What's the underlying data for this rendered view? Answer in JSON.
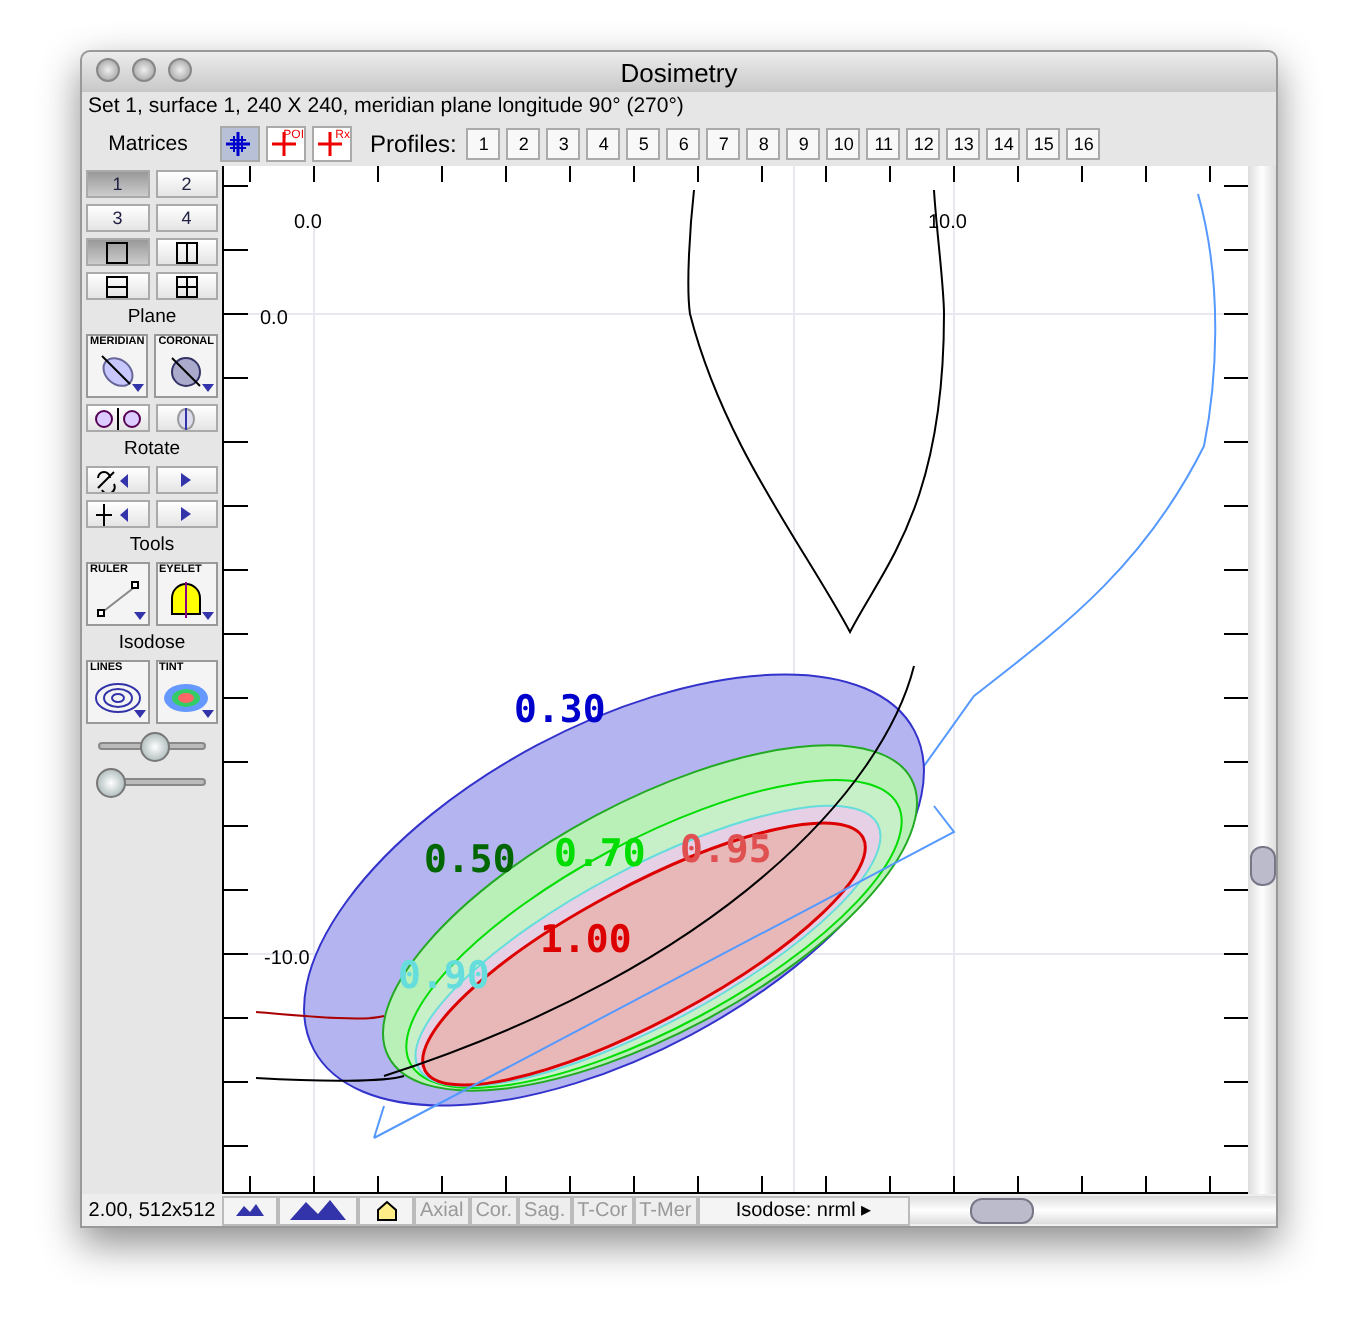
{
  "window": {
    "title": "Dosimetry"
  },
  "info": "Set 1, surface 1, 240 X 240, meridian plane longitude 90° (270°)",
  "toolbar": {
    "title": "Matrices",
    "tools": [
      {
        "kind": "cross",
        "selected": true
      },
      {
        "kind": "poi",
        "tag": "POI",
        "selected": false
      },
      {
        "kind": "rx",
        "tag": "Rx",
        "selected": false
      }
    ],
    "profiles_label": "Profiles:",
    "profiles": [
      "1",
      "2",
      "3",
      "4",
      "5",
      "6",
      "7",
      "8",
      "9",
      "10",
      "11",
      "12",
      "13",
      "14",
      "15",
      "16"
    ]
  },
  "sidebar": {
    "matrices": [
      {
        "label": "1",
        "selected": true
      },
      {
        "label": "2",
        "selected": false
      },
      {
        "label": "3",
        "selected": false
      },
      {
        "label": "4",
        "selected": false
      }
    ],
    "layouts": [
      {
        "kind": "single",
        "selected": true
      },
      {
        "kind": "vsplit",
        "selected": false
      },
      {
        "kind": "hsplit",
        "selected": false
      },
      {
        "kind": "quad",
        "selected": false
      }
    ],
    "sections": [
      {
        "title": "Plane",
        "tools": [
          {
            "kind": "meridian",
            "label": "MERIDIAN"
          },
          {
            "kind": "coronal",
            "label": "CORONAL"
          }
        ],
        "small": [
          {
            "kind": "swap"
          },
          {
            "kind": "slice"
          }
        ]
      },
      {
        "title": "Rotate",
        "small": [
          {
            "kind": "rotate"
          },
          {
            "kind": "right"
          },
          {
            "kind": "flip"
          },
          {
            "kind": "right"
          }
        ]
      },
      {
        "title": "Tools",
        "tools": [
          {
            "kind": "ruler",
            "label": "RULER"
          },
          {
            "kind": "eyelet",
            "label": "EYELET"
          }
        ]
      },
      {
        "title": "Isodose",
        "tools": [
          {
            "kind": "lines",
            "label": "LINES"
          },
          {
            "kind": "tint",
            "label": "TINT"
          }
        ]
      }
    ],
    "sliders": [
      {
        "level": 0.5
      },
      {
        "level": 0.1
      }
    ]
  },
  "canvas": {
    "x_labels": [
      "0.0",
      "10.0"
    ],
    "y_labels": [
      "0.0",
      "-10.0"
    ],
    "isodose_labels": [
      {
        "text": "0.30",
        "color": "#0000cc"
      },
      {
        "text": "0.50",
        "color": "#006600"
      },
      {
        "text": "0.70",
        "color": "#00dd00"
      },
      {
        "text": "0.95",
        "color": "#e05050"
      },
      {
        "text": "1.00",
        "color": "#dd0000"
      },
      {
        "text": "0.90",
        "color": "#66dddd"
      }
    ]
  },
  "status_bar": {
    "zoom": "2.00, 512x512",
    "views": [
      {
        "label": "Axial",
        "disabled": true
      },
      {
        "label": "Cor.",
        "disabled": true
      },
      {
        "label": "Sag.",
        "disabled": true
      },
      {
        "label": "T-Cor",
        "disabled": true
      },
      {
        "label": "T-Mer",
        "disabled": true
      }
    ],
    "isodose": "Isodose: nrml",
    "isodose_arrow": "▸"
  }
}
